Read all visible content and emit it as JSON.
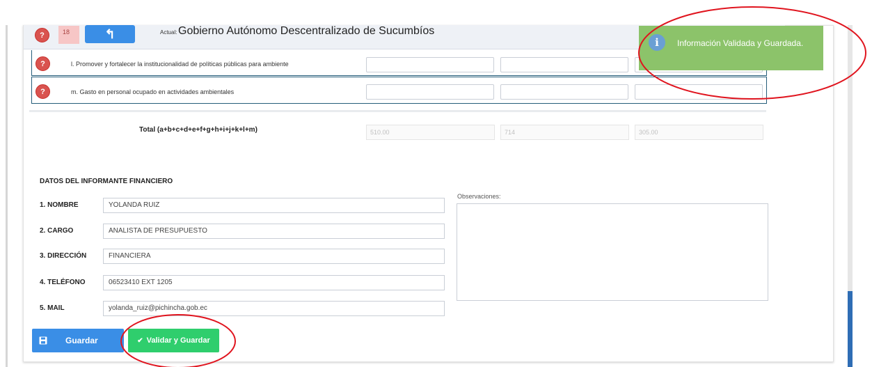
{
  "header": {
    "row_number": "18",
    "back_glyph": "↰",
    "actual_label": "Actual:",
    "entity_name": "Gobierno Autónomo Descentralizado de Sucumbíos",
    "help_glyph": "?"
  },
  "rows": [
    {
      "label": "l. Promover y fortalecer la institucionalidad de políticas públicas para ambiente"
    },
    {
      "label": "m. Gasto en personal ocupado en actividades ambientales"
    }
  ],
  "total": {
    "label": "Total (a+b+c+d+e+f+g+h+i+j+k+l+m)",
    "values": [
      "510.00",
      "714",
      "305.00"
    ]
  },
  "informant": {
    "section_title": "DATOS DEL INFORMANTE FINANCIERO",
    "fields": [
      {
        "label": "1. NOMBRE",
        "value": "YOLANDA RUIZ"
      },
      {
        "label": "2. CARGO",
        "value": "ANALISTA DE PRESUPUESTO"
      },
      {
        "label": "3. DIRECCIÓN",
        "value": "FINANCIERA"
      },
      {
        "label": "4. TELÉFONO",
        "value": "06523410 EXT 1205"
      },
      {
        "label": "5. MAIL",
        "value": "yolanda_ruiz@pichincha.gob.ec"
      }
    ],
    "observations_label": "Observaciones:"
  },
  "actions": {
    "save_label": "Guardar",
    "validate_label": "Validar y Guardar",
    "save_icon": "floppy-icon",
    "validate_icon": "check-icon"
  },
  "toast": {
    "message": "Información Validada y Guardada.",
    "icon": "i"
  },
  "colors": {
    "primary": "#3a8ee6",
    "success": "#2fce6d",
    "danger": "#d9534f",
    "toast_bg": "#8cc36a",
    "annotation": "#e0141e"
  }
}
